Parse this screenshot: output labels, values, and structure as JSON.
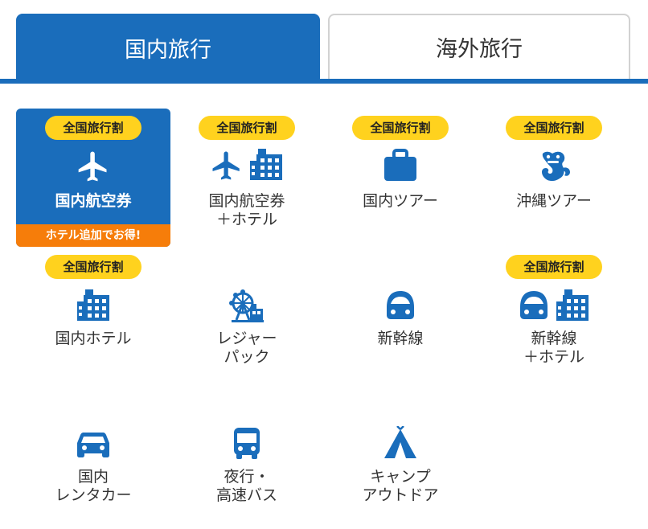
{
  "tabs": {
    "domestic": "国内旅行",
    "overseas": "海外旅行"
  },
  "colors": {
    "brand_blue": "#1a6dbb",
    "badge_yellow": "#ffd21e",
    "promo_orange": "#f67d0a"
  },
  "tiles": [
    {
      "label": "国内航空券",
      "badge": "全国旅行割",
      "promo": "ホテル追加でお得!",
      "icons": [
        "airplane-icon"
      ],
      "selected": true
    },
    {
      "label": "国内航空券\n＋ホテル",
      "badge": "全国旅行割",
      "icons": [
        "airplane-icon",
        "hotel-icon"
      ]
    },
    {
      "label": "国内ツアー",
      "badge": "全国旅行割",
      "icons": [
        "suitcase-icon"
      ]
    },
    {
      "label": "沖縄ツアー",
      "badge": "全国旅行割",
      "icons": [
        "shisa-icon"
      ]
    },
    {
      "label": "国内ホテル",
      "badge": "全国旅行割",
      "icons": [
        "hotel-icon"
      ]
    },
    {
      "label": "レジャー\nパック",
      "icons": [
        "ferris-wheel-icon"
      ]
    },
    {
      "label": "新幹線",
      "icons": [
        "shinkansen-icon"
      ]
    },
    {
      "label": "新幹線\n＋ホテル",
      "badge": "全国旅行割",
      "icons": [
        "shinkansen-icon",
        "hotel-icon"
      ]
    },
    {
      "label": "国内\nレンタカー",
      "icons": [
        "car-icon"
      ]
    },
    {
      "label": "夜行・\n高速バス",
      "icons": [
        "bus-icon"
      ]
    },
    {
      "label": "キャンプ\nアウトドア",
      "icons": [
        "tent-icon"
      ]
    }
  ]
}
